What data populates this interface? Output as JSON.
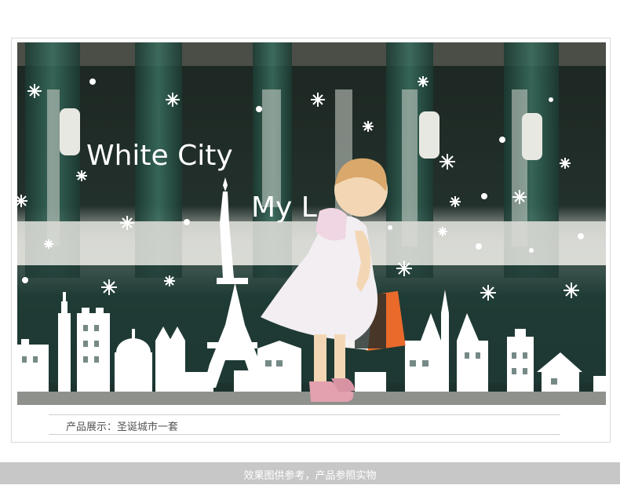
{
  "photo": {
    "sticker_title": "White City",
    "sticker_subtitle": "My L",
    "colors": {
      "glass_dark": "#1f2a26",
      "curtain_green": "#2f5a4c",
      "sticker_white": "#ffffff",
      "floor": "#8b8f8c"
    }
  },
  "caption": {
    "text": "产品展示：圣诞城市一套"
  },
  "footer": {
    "text": "效果图供参考，产品参照实物"
  }
}
